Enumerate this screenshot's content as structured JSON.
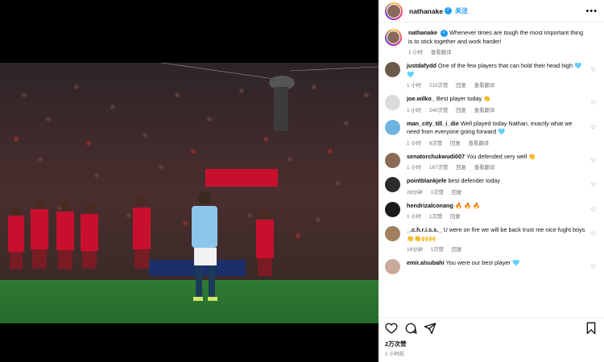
{
  "post": {
    "username": "nathanake",
    "follow_label": "关注",
    "more_label": "•••"
  },
  "caption": {
    "username": "nathanake",
    "text": "Whenever times are tough the most important thing is to stick together and work harder!",
    "time": "1 小时",
    "translate": "查看翻译"
  },
  "comments": [
    {
      "username": "justdafydd",
      "text": "One of the few players that can hold their head high 🩵🩵",
      "time": "1 小时",
      "likes": "210次赞",
      "reply": "回复",
      "translate": "查看翻译",
      "avatar_color": "#6b5a4a"
    },
    {
      "username": "joe.wilko_",
      "text": "Best player today 👏",
      "time": "1 小时",
      "likes": "240次赞",
      "reply": "回复",
      "translate": "查看翻译",
      "avatar_color": "#dbdbdb"
    },
    {
      "username": "man_city_till_i_die",
      "text": "Well played today Nathan, exactly what we need from everyone going forward 🩵",
      "time": "1 小时",
      "likes": "8次赞",
      "reply": "回复",
      "translate": "查看翻译",
      "avatar_color": "#6fb3e0"
    },
    {
      "username": "senatorchukwudi007",
      "text": "You defended very well 👏",
      "time": "1 小时",
      "likes": "167次赞",
      "reply": "回复",
      "translate": "查看翻译",
      "avatar_color": "#8b6b55"
    },
    {
      "username": "pointblankjefe",
      "text": "best defender today",
      "time": "28分钟",
      "likes": "1次赞",
      "reply": "回复",
      "translate": "",
      "avatar_color": "#2b2b2b"
    },
    {
      "username": "hendrizalconang",
      "text": "🔥 🔥 🔥",
      "time": "1 小时",
      "likes": "1次赞",
      "reply": "回复",
      "translate": "",
      "avatar_color": "#1a1a1a"
    },
    {
      "username": "_.c.h.r.i.s.s._",
      "text": "U were on fire we will be back trust me nice fught boys 👏👏🙌🙌",
      "time": "16分钟",
      "likes": "1次赞",
      "reply": "回复",
      "translate": "",
      "avatar_color": "#a08060"
    },
    {
      "username": "emir.alsubahi",
      "text": "You were our best player 🩵",
      "time": "",
      "likes": "",
      "reply": "",
      "translate": "",
      "avatar_color": "#c9a99a"
    }
  ],
  "icons": {
    "like": "heart-icon",
    "comment": "comment-icon",
    "share": "share-icon",
    "save": "bookmark-icon"
  },
  "likes_total": "2万次赞",
  "post_time": "1 小时前"
}
